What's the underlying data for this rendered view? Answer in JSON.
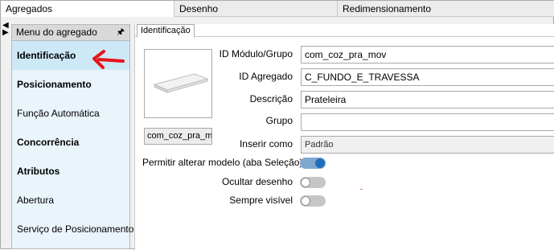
{
  "top_tabs": [
    {
      "label": "Agregados",
      "active": true
    },
    {
      "label": "Desenho",
      "active": false
    },
    {
      "label": "Redimensionamento",
      "active": false
    }
  ],
  "menu": {
    "title": "Menu do agregado",
    "items": [
      {
        "label": "Identificação",
        "bold": true,
        "selected": true
      },
      {
        "label": "Posicionamento",
        "bold": true,
        "selected": false
      },
      {
        "label": "Função Automática",
        "bold": false,
        "selected": false
      },
      {
        "label": "Concorrência",
        "bold": true,
        "selected": false
      },
      {
        "label": "Atributos",
        "bold": true,
        "selected": false
      },
      {
        "label": "Abertura",
        "bold": false,
        "selected": false
      },
      {
        "label": "Serviço de Posicionamento",
        "bold": false,
        "selected": false
      }
    ]
  },
  "content": {
    "tab_label": "Identificação",
    "preview_name": "com_coz_pra_mov",
    "fields": {
      "id_modulo": {
        "label": "ID Módulo/Grupo",
        "value": "com_coz_pra_mov"
      },
      "id_agregado": {
        "label": "ID Agregado",
        "value": "C_FUNDO_E_TRAVESSA"
      },
      "descricao": {
        "label": "Descrição",
        "value": "Prateleira"
      },
      "grupo": {
        "label": "Grupo",
        "value": ""
      },
      "inserir_como": {
        "label": "Inserir como",
        "value": "Padrão"
      }
    },
    "toggles": {
      "permitir": {
        "label": "Permitir alterar modelo (aba Seleção)",
        "on": true
      },
      "ocultar": {
        "label": "Ocultar desenho",
        "on": false
      },
      "sempre_visivel": {
        "label": "Sempre visível",
        "on": false
      }
    }
  },
  "colors": {
    "annotation_arrow": "#e8141a",
    "selected_item_bg": "#cde8f7",
    "toggle_on": "#1f6fb8"
  }
}
